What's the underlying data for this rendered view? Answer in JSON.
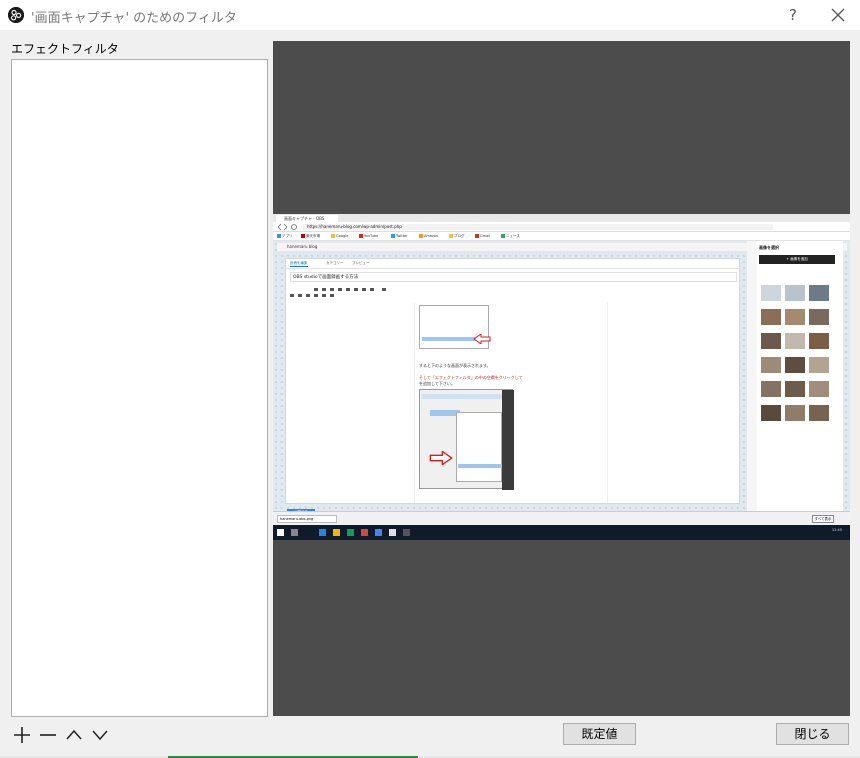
{
  "window": {
    "title": "'画面キャプチャ' のためのフィルタ",
    "help_label": "?",
    "close_label": "✕"
  },
  "effects": {
    "label": "エフェクトフィルタ",
    "items": []
  },
  "controls": {
    "add": "+",
    "remove": "—"
  },
  "buttons": {
    "defaults": "既定値",
    "close": "閉じる"
  },
  "preview": {
    "capture": {
      "tab_title": "画面キャプチャ - OBS",
      "url": "https://hanemaru-blog.com/wp-admin/post.php",
      "bookmarks": [
        "アプリ",
        "楽天市場",
        "Google",
        "YouTube",
        "Twitter",
        "Amazon",
        "ブログ",
        "Gmail",
        "ニュース"
      ],
      "site_name": "hanemaru blog",
      "editor_tabs": [
        "投稿を編集",
        "カテゴリー",
        "プレビュー"
      ],
      "post_title": "OBS studioで画面録画する方法",
      "text1": "すると下のような画面が表示されます。",
      "text2": "そして「エフェクトフィルタ」の中の空欄をクリックして",
      "text3": "を追加して下さい。",
      "publish_label": "公開する",
      "sidebar_title": "画像を選択",
      "sidebar_button": "+ 画像を追加",
      "download_file": "hanemaru-obs.png",
      "show_all": "すべて表示",
      "clock": "12:45"
    }
  }
}
